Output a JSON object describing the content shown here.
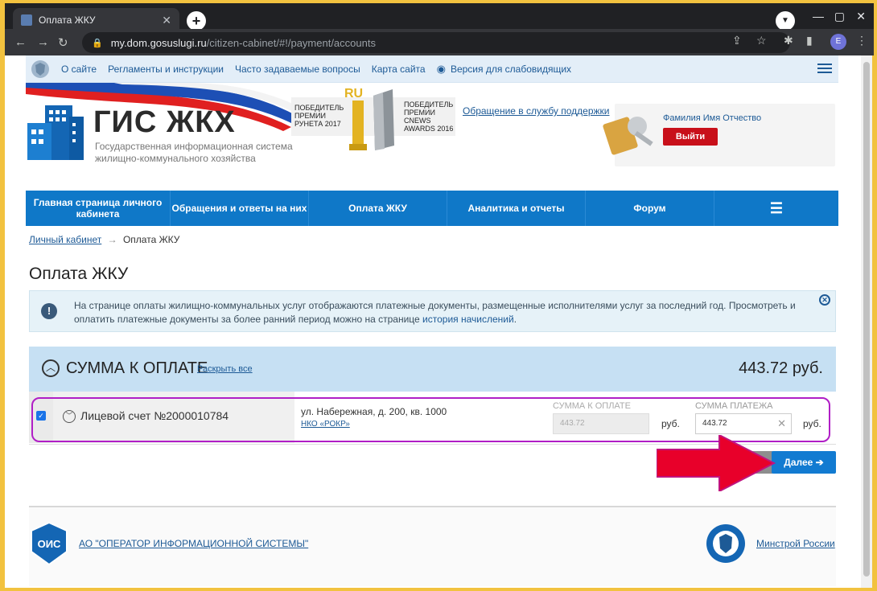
{
  "browser": {
    "tab_title": "Оплата ЖКУ",
    "tab_close": "✕",
    "new_tab": "+",
    "url_host": "my.dom.gosuslugi.ru",
    "url_path": "/citizen-cabinet/#!/payment/accounts",
    "profile_initial": "E",
    "minimize": "—",
    "maximize": "▢",
    "close": "✕"
  },
  "topstrip": {
    "links": [
      "О сайте",
      "Регламенты и инструкции",
      "Часто задаваемые вопросы",
      "Карта сайта"
    ],
    "accessibility": "Версия для слабовидящих"
  },
  "header": {
    "logo_title": "ГИС ЖКХ",
    "logo_subtitle": "Государственная информационная система жилищно-коммунального хозяйства",
    "award1": "ПОБЕДИТЕЛЬ ПРЕМИИ РУНЕТА 2017",
    "award2": "ПОБЕДИТЕЛЬ ПРЕМИИ CNEWS AWARDS 2016",
    "support_link": "Обращение в службу поддержки",
    "user_name": "Фамилия Имя Отчество",
    "logout": "Выйти"
  },
  "nav": {
    "items": [
      "Главная страница личного кабинета",
      "Обращения и ответы на них",
      "Оплата ЖКУ",
      "Аналитика и отчеты",
      "Форум"
    ]
  },
  "breadcrumb": {
    "home": "Личный кабинет",
    "sep": "→",
    "current": "Оплата ЖКУ"
  },
  "page_title": "Оплата ЖКУ",
  "notice": {
    "text": "На странице оплаты жилищно-коммунальных услуг отображаются платежные документы, размещенные исполнителями услуг за последний год. Просмотреть и оплатить платежные документы за более ранний период можно на странице",
    "link": "история начислений",
    "end": "."
  },
  "summary": {
    "title": "СУММА К ОПЛАТЕ",
    "expand_all": "Раскрыть все",
    "total": "443.72 руб."
  },
  "account": {
    "name": "Лицевой счет №2000010784",
    "address": "ул. Набережная, д. 200, кв. 1000",
    "org": "НКО «РОКР»",
    "due_label": "СУММА К ОПЛАТЕ",
    "due_value": "443.72",
    "pay_label": "СУММА ПЛАТЕЖА",
    "pay_value": "443.72",
    "currency": "руб.",
    "checked": true
  },
  "next_button": "Далее ➔",
  "footer": {
    "ois_badge": "ОИС",
    "ois_link": "АО \"ОПЕРАТОР ИНФОРМАЦИОННОЙ СИСТЕМЫ\"",
    "min_link": "Минстрой России"
  },
  "colors": {
    "accent": "#0f78c8",
    "highlight": "#b01ec6",
    "arrow": "#e8002a",
    "frame": "#f2c23f"
  }
}
